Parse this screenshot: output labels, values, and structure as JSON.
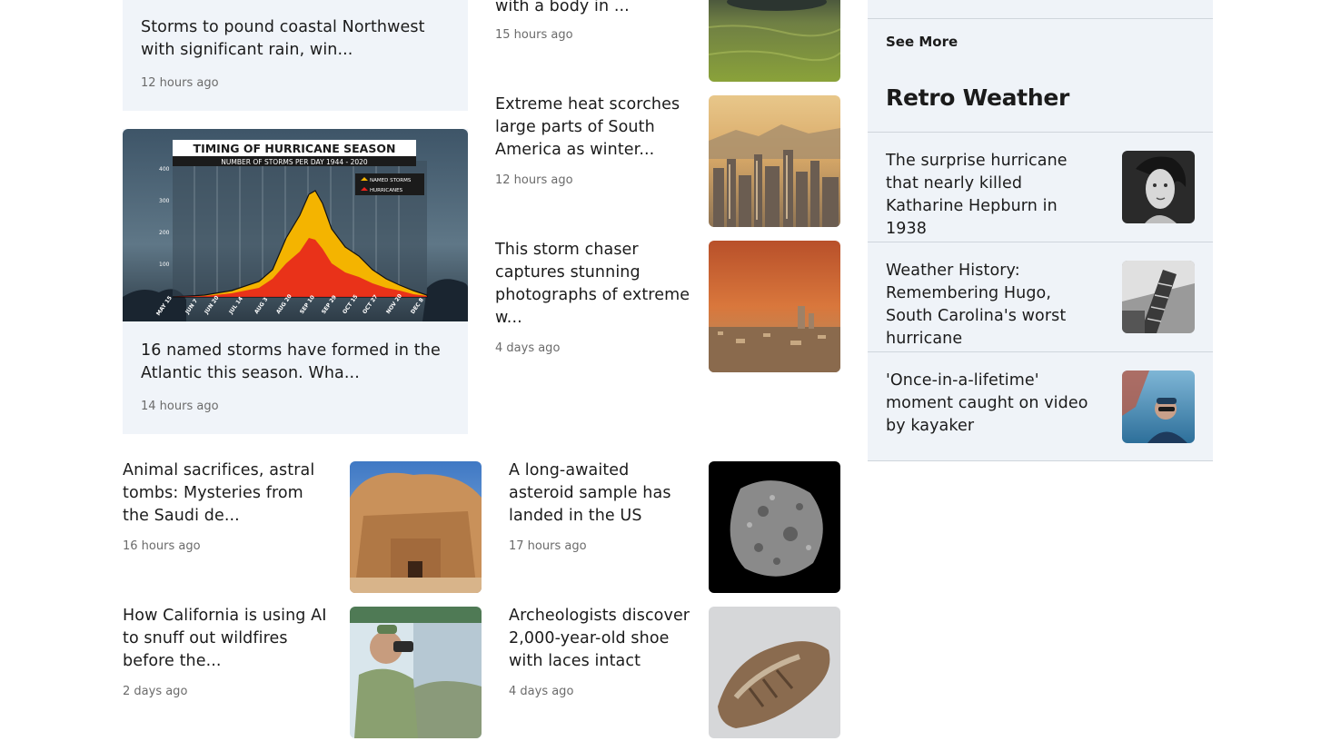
{
  "main": {
    "top_left_card": {
      "title": "Storms to pound coastal Northwest with significant rain, win...",
      "time": "12 hours ago"
    },
    "hurricane_card": {
      "title": "16 named storms have formed in the Atlantic this season. Wha...",
      "time": "14 hours ago",
      "graphic": {
        "heading": "TIMING OF HURRICANE SEASON",
        "subheading": "NUMBER OF STORMS PER DAY 1944 - 2020",
        "legend": [
          "NAMED STORMS",
          "HURRICANES"
        ],
        "y_ticks": [
          "400",
          "300",
          "200",
          "100"
        ],
        "x_ticks": [
          "MAY 15",
          "JUN 7",
          "JUN 20",
          "JUL 14",
          "AUG 3",
          "AUG 20",
          "SEP 10",
          "SEP 29",
          "OCT 15",
          "OCT 27",
          "NOV 20",
          "DEC 8"
        ]
      }
    },
    "middle_list": [
      {
        "title": "with a body in ...",
        "time": "15 hours ago",
        "image": "river-water-photo"
      },
      {
        "title": "Extreme heat scorches large parts of South America as winter...",
        "time": "12 hours ago",
        "image": "city-skyline-photo"
      },
      {
        "title": "This storm chaser captures stunning photographs of extreme w...",
        "time": "4 days ago",
        "image": "dust-storm-photo"
      }
    ],
    "bottom_grid": [
      {
        "title": "Animal sacrifices, astral tombs: Mysteries from the Saudi de...",
        "time": "16 hours ago",
        "image": "desert-tomb-photo"
      },
      {
        "title": "A long-awaited asteroid sample has landed in the US",
        "time": "17 hours ago",
        "image": "asteroid-photo"
      },
      {
        "title": "How California is using AI to snuff out wildfires before the...",
        "time": "2 days ago",
        "image": "lookout-binoculars-photo"
      },
      {
        "title": "Archeologists discover 2,000-year-old shoe with laces intact",
        "time": "4 days ago",
        "image": "ancient-shoe-photo"
      }
    ]
  },
  "sidebar": {
    "see_more": "See More",
    "section_title": "Retro Weather",
    "items": [
      {
        "title": "The surprise hurricane that nearly killed Katharine Hepburn in 1938",
        "image": "portrait-photo"
      },
      {
        "title": "Weather History: Remembering Hugo, South Carolina's worst hurricane",
        "image": "storm-damage-photo"
      },
      {
        "title": "'Once-in-a-lifetime' moment caught on video by kayaker",
        "image": "kayaker-selfie-photo"
      }
    ]
  },
  "colors": {
    "card_bg": "#f0f4f9",
    "rail_bg": "#eff3f8",
    "named_storms": "#f4b400",
    "hurricanes": "#e8231c"
  }
}
